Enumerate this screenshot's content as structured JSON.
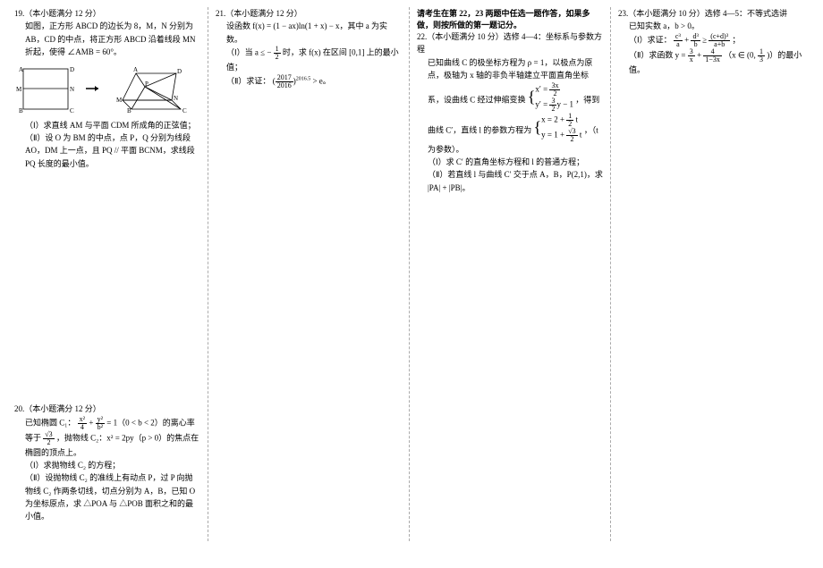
{
  "q19": {
    "header": "19.（本小题满分 12 分）",
    "body1": "如图，正方形 ABCD 的边长为 8，M，N 分别为 AB，CD 的中点，将正方形 ABCD 沿着线段 MN 折起，使得 ∠AMB = 60°。",
    "part1": "（Ⅰ）求直线 AM 与平面 CDM 所成角的正弦值；",
    "part2": "（Ⅱ）设 O 为 BM 的中点，点 P，Q 分别为线段 AO，DM 上一点，且 PQ // 平面 BCNM，求线段 PQ 长度的最小值。"
  },
  "q20": {
    "header": "20.（本小题满分 12 分）",
    "body1_pre": "已知椭圆 C₁：",
    "body1_mid": " = 1（0 < b < 2）的离心率等于 ",
    "body1_post": "，抛物线 C₂：x² = 2py（p > 0）的焦点在椭圆的顶点上。",
    "part1": "（Ⅰ）求抛物线 C₂ 的方程；",
    "part2": "（Ⅱ）设抛物线 C₂ 的准线上有动点 P，过 P 向抛物线 C₂ 作两条切线，切点分别为 A，B，已知 O 为坐标原点，求 △POA 与 △POB 面积之和的最小值。"
  },
  "q21": {
    "header": "21.（本小题满分 12 分）",
    "body1": "设函数 f(x) = (1 − ax)ln(1 + x) − x，其中 a 为实数。",
    "part1_pre": "（Ⅰ）当 a ≤ −",
    "part1_post": " 时，求 f(x) 在区间 [0,1] 上的最小值；",
    "part2_pre": "（Ⅱ）求证：",
    "part2_post": " > e。"
  },
  "choice_note": "请考生在第 22，23 两题中任选一题作答，如果多做，则按所做的第一题记分。",
  "q22": {
    "header": "22.（本小题满分 10 分）选修 4—4：坐标系与参数方程",
    "body1": "已知曲线 C 的极坐标方程为 ρ = 1，以极点为原点，极轴为 x 轴的非负半轴建立平面直角坐标系，设曲线 C 经过伸缩变换 ",
    "body1_post": "，得到曲线 C′，直线 l 的参数方程为 ",
    "body1_end": "，（t 为参数）。",
    "part1": "（Ⅰ）求 C′ 的直角坐标方程和 l 的普通方程；",
    "part2": "（Ⅱ）若直线 l 与曲线 C′ 交于点 A，B，P(2,1)，求 |PA| + |PB|。",
    "sys1a": "x′ = ",
    "sys1b": "y′ = ",
    "sys1c": "y − 1",
    "sys2a": "x = 2 + ",
    "sys2at": " t",
    "sys2b": "y = 1 + ",
    "sys2bt": " t"
  },
  "q23": {
    "header": "23.（本小题满分 10 分）选修 4—5：不等式选讲",
    "body1": "已知实数 a，b > 0。",
    "part1_pre": "（Ⅰ）求证：",
    "part1_post": "；",
    "part2_pre": "（Ⅱ）求函数 y = ",
    "part2_mid": "（x ∈ (0, ",
    "part2_post": ")）的最小值。"
  }
}
